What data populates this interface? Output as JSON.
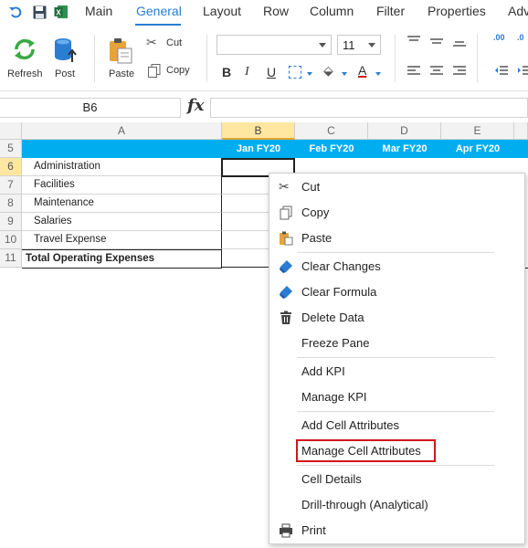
{
  "quick_access": {
    "icons": [
      "undo-icon",
      "save-icon",
      "excel-icon"
    ]
  },
  "menu_tabs": [
    {
      "label": "Main"
    },
    {
      "label": "General"
    },
    {
      "label": "Layout"
    },
    {
      "label": "Row"
    },
    {
      "label": "Column"
    },
    {
      "label": "Filter"
    },
    {
      "label": "Properties"
    },
    {
      "label": "Adv"
    }
  ],
  "ribbon": {
    "refresh_label": "Refresh",
    "post_label": "Post",
    "paste_label": "Paste",
    "cut_label": "Cut",
    "copy_label": "Copy",
    "font_family_value": "",
    "font_size_value": "11",
    "bold_label": "B",
    "italic_label": "I",
    "underline_label": "U",
    "font_color_label": "A",
    "decimal_inc_label": ".00",
    "decimal_dec_label": ".0"
  },
  "formula_bar": {
    "name_box": "B6",
    "fx_label": "fx",
    "formula_value": ""
  },
  "grid": {
    "columns": [
      "A",
      "B",
      "C",
      "D",
      "E"
    ],
    "rows": [
      "5",
      "6",
      "7",
      "8",
      "9",
      "10",
      "11"
    ],
    "month_headers": [
      "Jan FY20",
      "Feb FY20",
      "Mar FY20",
      "Apr FY20"
    ],
    "row_labels": [
      "Administration",
      "Facilities",
      "Maintenance",
      "Salaries",
      "Travel Expense",
      "Total Operating Expenses"
    ],
    "selected_cell": "B6"
  },
  "context_menu": {
    "items": [
      {
        "label": "Cut",
        "icon": "scissors-icon"
      },
      {
        "label": "Copy",
        "icon": "copy-icon"
      },
      {
        "label": "Paste",
        "icon": "paste-icon"
      },
      {
        "label": "Clear Changes",
        "icon": "eraser-icon"
      },
      {
        "label": "Clear Formula",
        "icon": "eraser-icon"
      },
      {
        "label": "Delete Data",
        "icon": "trash-icon"
      },
      {
        "label": "Freeze Pane",
        "icon": ""
      },
      {
        "label": "Add KPI",
        "icon": ""
      },
      {
        "label": "Manage KPI",
        "icon": ""
      },
      {
        "label": "Add Cell Attributes",
        "icon": ""
      },
      {
        "label": "Manage Cell Attributes",
        "icon": ""
      },
      {
        "label": "Cell Details",
        "icon": ""
      },
      {
        "label": "Drill-through (Analytical)",
        "icon": ""
      },
      {
        "label": "Print",
        "icon": "printer-icon"
      }
    ],
    "highlighted_item": "Manage Cell Attributes"
  },
  "colors": {
    "accent": "#2b7cd3",
    "header_band": "#00aeef",
    "selected_header": "#ffe7a1",
    "highlight_border": "#d0161c"
  }
}
